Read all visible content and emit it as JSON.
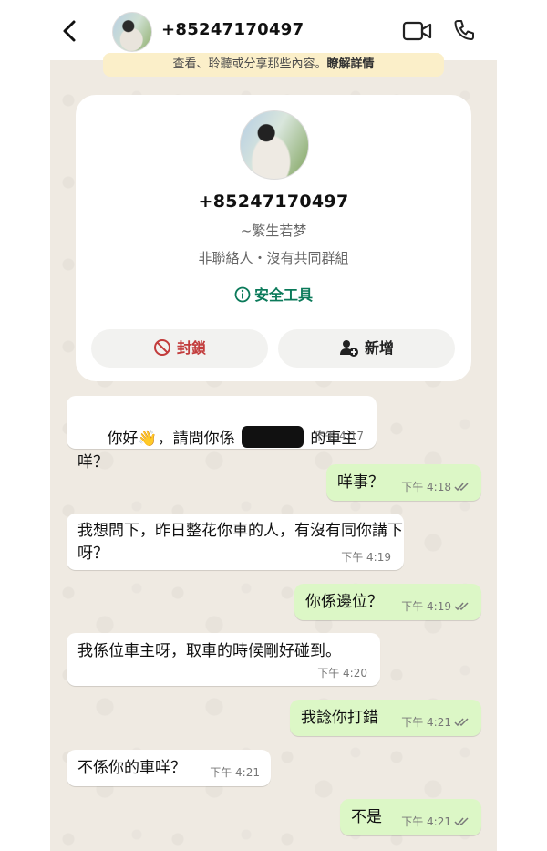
{
  "header": {
    "title": "+85247170497"
  },
  "notice": {
    "text": "查看、聆聽或分享那些內容。",
    "link": "瞭解詳情"
  },
  "profile": {
    "number": "+85247170497",
    "nickname": "~繁生若梦",
    "info": "非聯絡人・沒有共同群組",
    "safety_label": "安全工具",
    "block_label": "封鎖",
    "add_label": "新增"
  },
  "messages": [
    {
      "dir": "in",
      "text_before": "你好👋，請問你係 ",
      "text_after": " 的車主咩？",
      "time": "下午 4:17"
    },
    {
      "dir": "out",
      "text": "咩事？",
      "time": "下午 4:18"
    },
    {
      "dir": "in",
      "text": "我想問下，昨日整花你車的人，有沒有同你講下呀？",
      "time": "下午 4:19"
    },
    {
      "dir": "out",
      "text": "你係邊位？",
      "time": "下午 4:19"
    },
    {
      "dir": "in",
      "text": "我係位車主呀，取車的時候剛好碰到。",
      "time": "下午 4:20"
    },
    {
      "dir": "out",
      "text": "我諗你打錯",
      "time": "下午 4:21"
    },
    {
      "dir": "in",
      "text": "不係你的車咩？",
      "time": "下午 4:21"
    },
    {
      "dir": "out",
      "text": "不是",
      "time": "下午 4:21"
    }
  ],
  "colors": {
    "background": "#efeae2",
    "outgoing": "#dcf7c6",
    "incoming": "#ffffff",
    "accent_green": "#0b7a5a",
    "block_red": "#c23c3c",
    "read_ticks": "#7a7a7a"
  }
}
